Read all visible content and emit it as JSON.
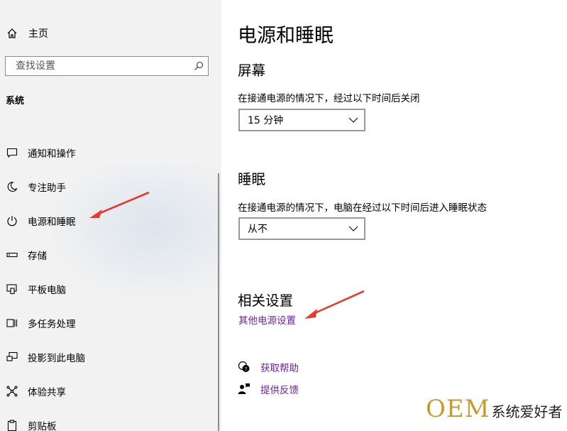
{
  "sidebar": {
    "home_label": "主页",
    "search_placeholder": "查找设置",
    "section_title": "系统",
    "items": [
      {
        "label": "通知和操作",
        "icon": "notification-icon"
      },
      {
        "label": "专注助手",
        "icon": "moon-icon"
      },
      {
        "label": "电源和睡眠",
        "icon": "power-icon"
      },
      {
        "label": "存储",
        "icon": "storage-icon"
      },
      {
        "label": "平板电脑",
        "icon": "tablet-icon"
      },
      {
        "label": "多任务处理",
        "icon": "multitask-icon"
      },
      {
        "label": "投影到此电脑",
        "icon": "project-icon"
      },
      {
        "label": "体验共享",
        "icon": "share-icon"
      },
      {
        "label": "剪贴板",
        "icon": "clipboard-icon"
      }
    ]
  },
  "main": {
    "title": "电源和睡眠",
    "screen": {
      "heading": "屏幕",
      "description": "在接通电源的情况下，经过以下时间后关闭",
      "value": "15 分钟"
    },
    "sleep": {
      "heading": "睡眠",
      "description": "在接通电源的情况下，电脑在经过以下时间后进入睡眠状态",
      "value": "从不"
    },
    "related": {
      "heading": "相关设置",
      "link": "其他电源设置"
    },
    "help": {
      "get_help": "获取帮助",
      "feedback": "提供反馈"
    }
  },
  "watermark": {
    "brand": "OEM",
    "text": "系统爱好者"
  },
  "colors": {
    "link": "#6b1fa8",
    "annotation_arrow": "#e8392b",
    "sidebar_bg": "#f2f2f2",
    "watermark_gold": "#c89a2e"
  }
}
